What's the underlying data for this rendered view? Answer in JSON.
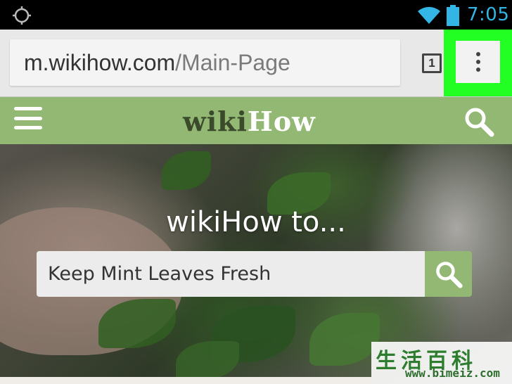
{
  "status_bar": {
    "time": "7:05",
    "icons": [
      "gps-icon",
      "wifi-icon",
      "battery-icon"
    ],
    "time_color": "#33b5e5"
  },
  "browser": {
    "url_host": "m.wikihow.com",
    "url_path": "/Main-Page",
    "tab_count": "1",
    "menu_icon": "overflow-menu-icon",
    "highlight_color": "#22ff22"
  },
  "wikihow_header": {
    "logo_part1": "wiki",
    "logo_part2": "How",
    "menu_icon": "hamburger-icon",
    "search_icon": "search-icon",
    "bg_color": "#93b874"
  },
  "hero": {
    "title": "wikiHow to...",
    "search_value": "Keep Mint Leaves Fresh",
    "search_button_icon": "search-icon"
  },
  "watermark": {
    "chars": "生活百科",
    "url": "www.bimeiz.com"
  }
}
